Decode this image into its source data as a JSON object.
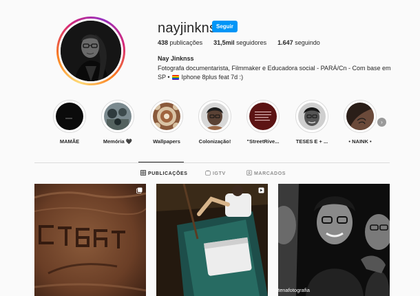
{
  "profile": {
    "username": "nayjinknss",
    "follow_label": "Seguir",
    "stats": [
      {
        "value": "438",
        "label": "publicações"
      },
      {
        "value": "31,5mil",
        "label": "seguidores"
      },
      {
        "value": "1.647",
        "label": "seguindo"
      }
    ],
    "full_name": "Nay Jinknss",
    "bio_line1": "Fotografa documentarista, Filmmaker e Educadora social - PARÁ/Cn - Com base em",
    "bio_line2_before": "SP •",
    "bio_line2_after": "Iphone 8plus feat 7d :)"
  },
  "highlights": [
    {
      "label": "MAMÃE"
    },
    {
      "label": "Memória 🖤"
    },
    {
      "label": "Wallpapers"
    },
    {
      "label": "Colonização!"
    },
    {
      "label": "\"StreetRive..."
    },
    {
      "label": "TESES E + ..."
    },
    {
      "label": "• NAINK •"
    }
  ],
  "tabs": [
    {
      "label": "PUBLICAÇÕES",
      "icon": "grid-icon",
      "active": true
    },
    {
      "label": "IGTV",
      "icon": "igtv-icon",
      "active": false
    },
    {
      "label": "MARCADOS",
      "icon": "tagged-icon",
      "active": false
    }
  ],
  "posts": [
    {
      "badge": "carousel-icon",
      "overlay_text": ""
    },
    {
      "badge": "video-icon",
      "overlay_text": ""
    },
    {
      "badge": "",
      "overlay_text": "tenafotografia"
    }
  ],
  "colors": {
    "follow_button": "#0095f6",
    "text_primary": "#262626",
    "text_secondary": "#8e8e8e",
    "divider": "#dbdbdb",
    "background": "#fafafa"
  }
}
